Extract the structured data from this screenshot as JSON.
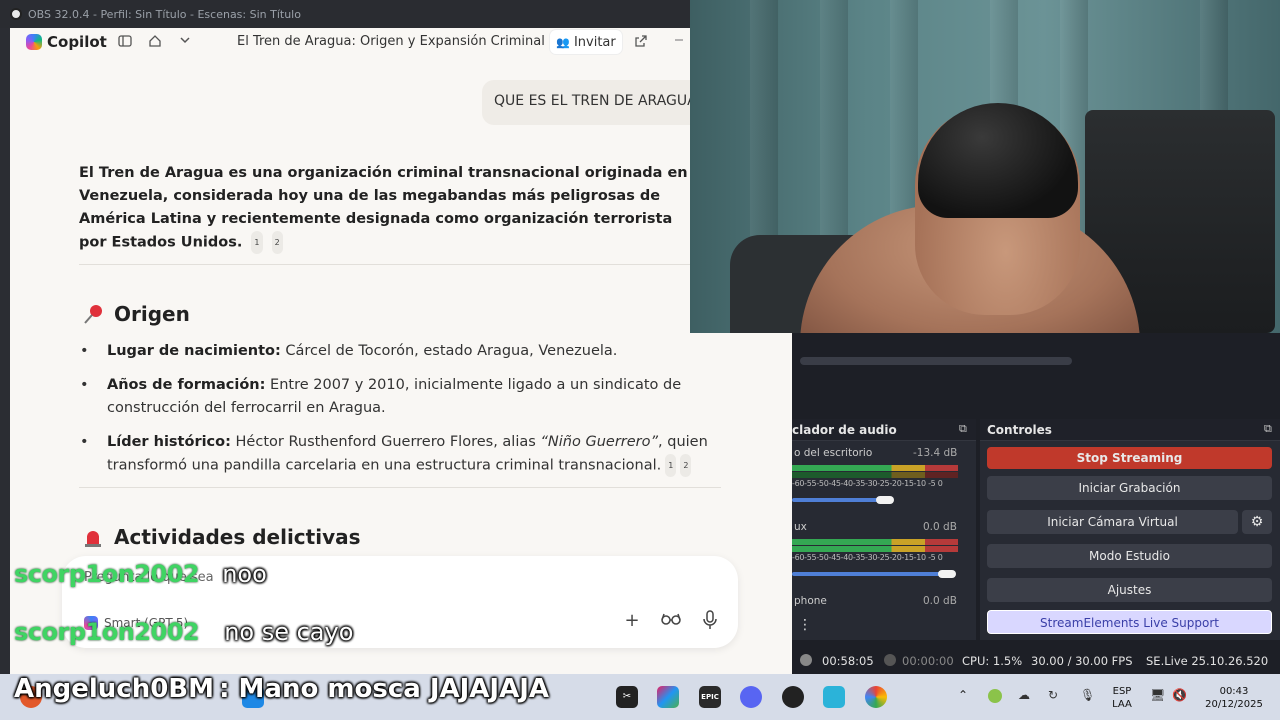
{
  "obs": {
    "window_title": "OBS 32.0.4 - Perfil: Sin Título - Escenas: Sin Título",
    "audio_mixer": {
      "title": "clador de audio",
      "tracks": [
        {
          "name": "o del escritorio",
          "db": "-13.4 dB",
          "level_pct": 80
        },
        {
          "name": "ux",
          "db": "0.0 dB",
          "level_pct": 85
        },
        {
          "name": "phone",
          "db": "0.0 dB",
          "level_pct": 0
        }
      ],
      "scale": "-60-55-50-45-40-35-30-25-20-15-10 -5 0"
    },
    "controls": {
      "title": "Controles",
      "stop_streaming": "Stop Streaming",
      "start_recording": "Iniciar Grabación",
      "virtual_camera": "Iniciar Cámara Virtual",
      "studio_mode": "Modo Estudio",
      "settings": "Ajustes",
      "se_live": "StreamElements Live Support"
    },
    "status": {
      "stream_time": "00:58:05",
      "rec_time": "00:00:00",
      "cpu": "CPU: 1.5%",
      "fps": "30.00 / 30.00 FPS",
      "version": "SE.Live 25.10.26.520"
    },
    "colors": {
      "stop_streaming": "#c0392b",
      "se_live": "#d9d7ff"
    }
  },
  "copilot": {
    "brand": "Copilot",
    "chat_title": "El Tren de Aragua: Origen y Expansión Criminal",
    "invite": "Invitar",
    "user_message": "QUE ES EL TREN DE ARAGUA",
    "intro": "El Tren de Aragua es una organización criminal transnacional originada en Venezuela, considerada hoy una de las megabandas más peligrosas de América Latina y recientemente designada como organización terrorista por Estados Unidos.",
    "cite1": "1",
    "cite2": "2",
    "origin_heading": "Origen",
    "origin": [
      {
        "label": "Lugar de nacimiento:",
        "text": " Cárcel de Tocorón, estado Aragua, Venezuela."
      },
      {
        "label": "Años de formación:",
        "text": " Entre 2007 y 2010, inicialmente ligado a un sindicato de construcción del ferrocarril en Aragua."
      },
      {
        "label": "Líder histórico:",
        "text_before": " Héctor Rusthenford Guerrero Flores, alias ",
        "alias": "“Niño Guerrero”",
        "text_after": ", quien transformó una pandilla carcelaria en una estructura criminal transnacional."
      }
    ],
    "activities_heading": "Actividades delictivas",
    "prompt_placeholder": "Pregunta lo que sea",
    "model": "Smart (GPT-5)"
  },
  "chat_overlay": [
    {
      "user": "scorp1on2002",
      "message": "noo"
    },
    {
      "user": "scorp1on2002",
      "message": "no se cayo"
    },
    {
      "user": "Angeluch0BM",
      "message": ": Mano mosca JAJAJAJA"
    }
  ],
  "taskbar": {
    "lang_top": "ESP",
    "lang_bottom": "LAA",
    "time": "00:43",
    "date": "20/12/2025",
    "app_label_epic": "EPIC"
  }
}
